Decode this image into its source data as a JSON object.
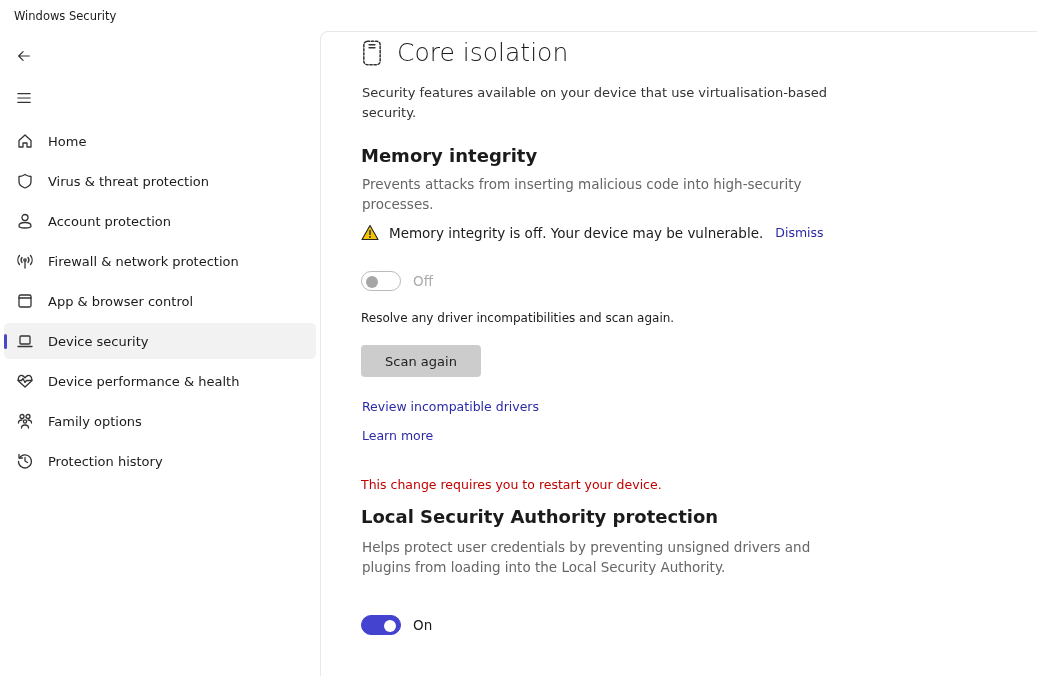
{
  "window": {
    "title": "Windows Security"
  },
  "sidebar": {
    "items": [
      {
        "label": "Home",
        "selected": false
      },
      {
        "label": "Virus & threat protection",
        "selected": false
      },
      {
        "label": "Account protection",
        "selected": false
      },
      {
        "label": "Firewall & network protection",
        "selected": false
      },
      {
        "label": "App & browser control",
        "selected": false
      },
      {
        "label": "Device security",
        "selected": true
      },
      {
        "label": "Device performance & health",
        "selected": false
      },
      {
        "label": "Family options",
        "selected": false
      },
      {
        "label": "Protection history",
        "selected": false
      }
    ]
  },
  "page": {
    "title": "Core isolation",
    "description": "Security features available on your device that use virtualisation-based security.",
    "sections": [
      {
        "title": "Memory integrity",
        "description": "Prevents attacks from inserting malicious code into high-security processes.",
        "warning": {
          "text": "Memory integrity is off. Your device may be vulnerable.",
          "action": "Dismiss"
        },
        "toggle": {
          "on": false,
          "disabled": true,
          "label": "Off"
        },
        "note": "Resolve any driver incompatibilities and scan again.",
        "button": "Scan again",
        "links": [
          "Review incompatible drivers",
          "Learn more"
        ],
        "restart_notice": "This change requires you to restart your device."
      },
      {
        "title": "Local Security Authority protection",
        "description": "Helps protect user credentials by preventing unsigned drivers and plugins from loading into the Local Security Authority.",
        "toggle": {
          "on": true,
          "disabled": false,
          "label": "On"
        }
      }
    ]
  }
}
